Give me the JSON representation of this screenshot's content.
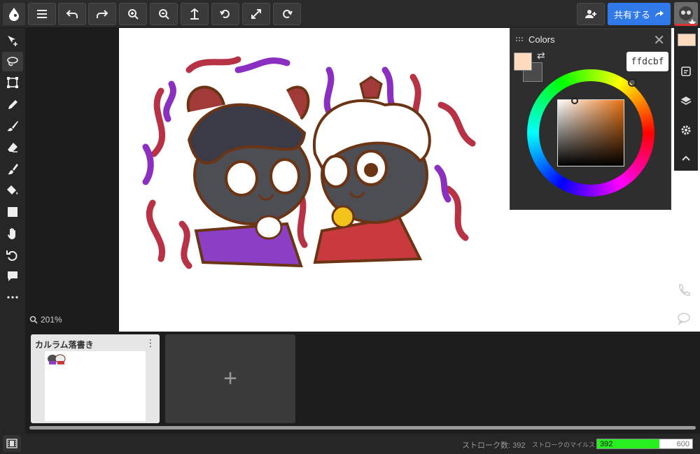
{
  "toolbar": {
    "buttons": [
      "menu-icon",
      "undo-icon",
      "redo-icon",
      "zoom-in-icon",
      "zoom-out-icon",
      "fit-icon",
      "rotate-left-icon",
      "fullscreen-icon",
      "rotate-right-icon"
    ],
    "share_label": "共有する",
    "invite_icon": "add-user-icon"
  },
  "tools": [
    "move",
    "lasso",
    "transform",
    "eyedropper",
    "brush",
    "eraser",
    "smudge",
    "fill",
    "rectangle",
    "hand",
    "reset-rotation",
    "comment",
    "more"
  ],
  "active_tool": "lasso",
  "zoom": {
    "label": "201%"
  },
  "colors_panel": {
    "title": "Colors",
    "hex": "ffdcbf",
    "foreground": "#ffdcbf",
    "background": "#4a4a4a"
  },
  "frames": {
    "items": [
      {
        "name": "カルラム落書き"
      }
    ],
    "add_label": "+"
  },
  "status": {
    "strokes_label": "ストローク数: 392",
    "milestone_label": "ストロークのマイルストーン:",
    "progress_value": "392",
    "progress_max": "600",
    "progress_fraction": 0.653
  }
}
